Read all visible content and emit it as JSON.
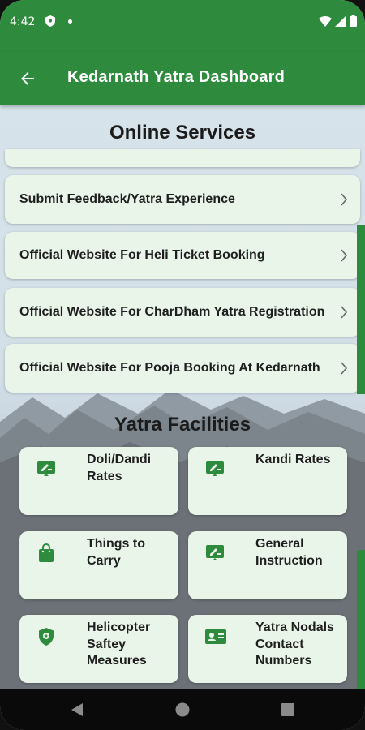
{
  "status_bar": {
    "time": "4:42"
  },
  "app_bar": {
    "title": "Kedarnath Yatra Dashboard"
  },
  "online_services": {
    "title": "Online Services",
    "items": [
      {
        "label": "Submit Feedback/Yatra Experience"
      },
      {
        "label": "Official Website For Heli Ticket Booking"
      },
      {
        "label": "Official Website For CharDham Yatra Registration"
      },
      {
        "label": "Official Website For Pooja Booking At Kedarnath"
      }
    ]
  },
  "yatra_facilities": {
    "title": "Yatra Facilities",
    "tiles": [
      {
        "label": "Doli/Dandi Rates",
        "icon": "rate-card-icon"
      },
      {
        "label": "Kandi Rates",
        "icon": "rate-card-icon"
      },
      {
        "label": "Things to Carry",
        "icon": "shopping-bag-icon"
      },
      {
        "label": "General Instruction",
        "icon": "rate-card-icon"
      },
      {
        "label": "Helicopter Saftey Measures",
        "icon": "shield-icon"
      },
      {
        "label": "Yatra Nodals Contact Numbers",
        "icon": "contact-card-icon"
      }
    ]
  },
  "colors": {
    "primary": "#2e8b3d",
    "card_bg": "#eaf5ea"
  }
}
